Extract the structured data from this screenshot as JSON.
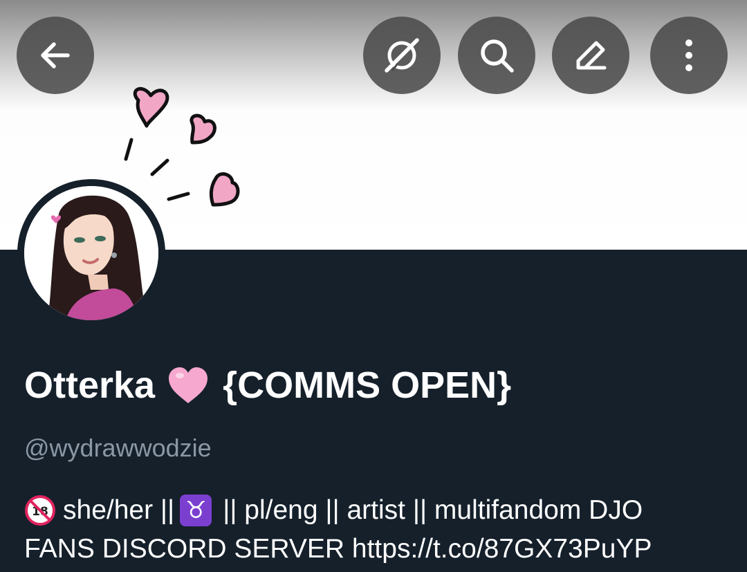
{
  "top_bar": {
    "back_icon": "arrow-left-icon",
    "grok_icon": "grok-icon",
    "search_icon": "search-icon",
    "edit_icon": "pencil-icon",
    "more_icon": "more-vertical-icon"
  },
  "profile": {
    "name": "Otterka",
    "name_emoji": "pink-heart",
    "name_suffix": "{COMMS OPEN}",
    "handle": "@wydrawwodzie",
    "bio": {
      "line1_part1": "she/her ||",
      "line1_part2": "|| pl/eng || artist || multifandom  DJO",
      "line2_text": "FANS DISCORD SERVER ",
      "link": "https://t.co/87GX73PuYP",
      "emoji1": "no-one-under-eighteen",
      "emoji2": "taurus"
    }
  },
  "colors": {
    "background": "#15202b",
    "handle": "#8b98a5",
    "button": "#4b4b4b",
    "heart": "#f4a6c8",
    "taurus": "#7b3fd0"
  }
}
